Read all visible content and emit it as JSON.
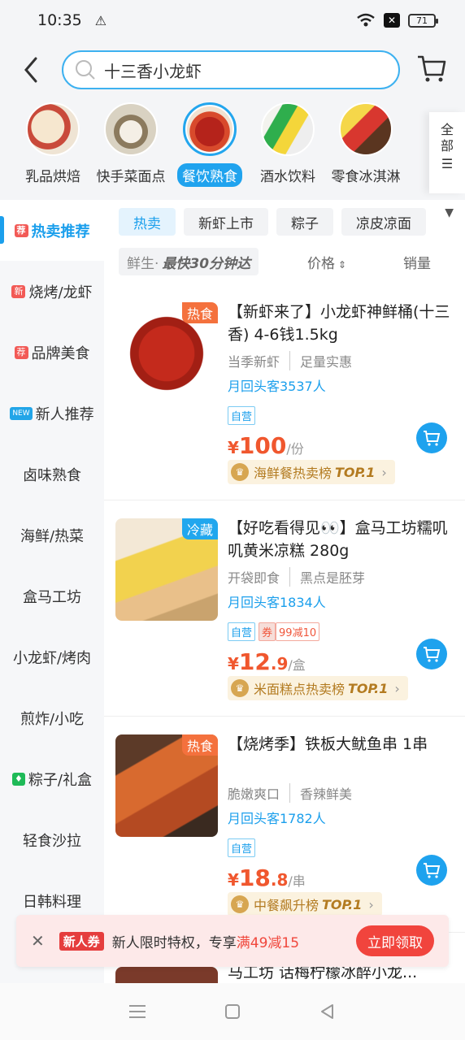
{
  "status": {
    "time": "10:35",
    "battery": "71"
  },
  "search": {
    "query": "十三香小龙虾"
  },
  "categories": [
    {
      "label": "乳品烘焙",
      "icon": "dairy-bakery-image"
    },
    {
      "label": "快手菜面点",
      "icon": "quick-dishes-image"
    },
    {
      "label": "餐饮熟食",
      "icon": "crayfish-image",
      "active": true
    },
    {
      "label": "酒水饮料",
      "icon": "drinks-image"
    },
    {
      "label": "零食冰淇淋",
      "icon": "snacks-image"
    }
  ],
  "all_label": "全部",
  "sidebar": [
    {
      "label": "热卖推荐",
      "tag": "荐",
      "active": true
    },
    {
      "label": "烧烤/龙虾",
      "tag": "新"
    },
    {
      "label": "品牌美食",
      "tag": "荐"
    },
    {
      "label": "新人推荐",
      "tag": "NEW"
    },
    {
      "label": "卤味熟食"
    },
    {
      "label": "海鲜/热菜"
    },
    {
      "label": "盒马工坊"
    },
    {
      "label": "小龙虾/烤肉"
    },
    {
      "label": "煎炸/小吃"
    },
    {
      "label": "粽子/礼盒",
      "tag": "♦"
    },
    {
      "label": "轻食沙拉"
    },
    {
      "label": "日韩料理"
    }
  ],
  "tags": [
    "热卖",
    "新虾上市",
    "粽子",
    "凉皮凉面"
  ],
  "sort": {
    "fresh": "鲜生·",
    "fresh_bold": "最快30分钟达",
    "price": "价格",
    "sales": "销量"
  },
  "products": [
    {
      "badge": "热食",
      "title": "【新虾来了】小龙虾神鲜桶(十三香) 4-6钱1.5kg",
      "sub1": "当季新虾",
      "sub2": "足量实惠",
      "repeat": "月回头客3537人",
      "tag1": "自营",
      "price_sym": "¥",
      "price_int": "100",
      "price_dec": "",
      "price_unit": "/份",
      "rank": "海鲜餐热卖榜",
      "rank_top": "TOP.1"
    },
    {
      "badge": "冷藏",
      "title": "【好吃看得见👀】盒马工坊糯叽叽黄米凉糕 280g",
      "sub1": "开袋即食",
      "sub2": "黑点是胚芽",
      "repeat": "月回头客1834人",
      "tag1": "自营",
      "coupon_label": "券",
      "coupon": "99减10",
      "price_sym": "¥",
      "price_int": "12",
      "price_dec": ".9",
      "price_unit": "/盒",
      "rank": "米面糕点热卖榜",
      "rank_top": "TOP.1"
    },
    {
      "badge": "热食",
      "title": "【烧烤季】铁板大鱿鱼串 1串",
      "sub1": "脆嫩爽口",
      "sub2": "香辣鲜美",
      "repeat": "月回头客1782人",
      "tag1": "自营",
      "price_sym": "¥",
      "price_int": "18",
      "price_dec": ".8",
      "price_unit": "/串",
      "rank": "中餐飙升榜",
      "rank_top": "TOP.1"
    }
  ],
  "promo": {
    "badge": "新人券",
    "text": "新人限时特权，专享",
    "highlight": "满49减15",
    "button": "立即领取"
  },
  "peek_title": "马工坊 话梅柠檬冰醉小龙..."
}
